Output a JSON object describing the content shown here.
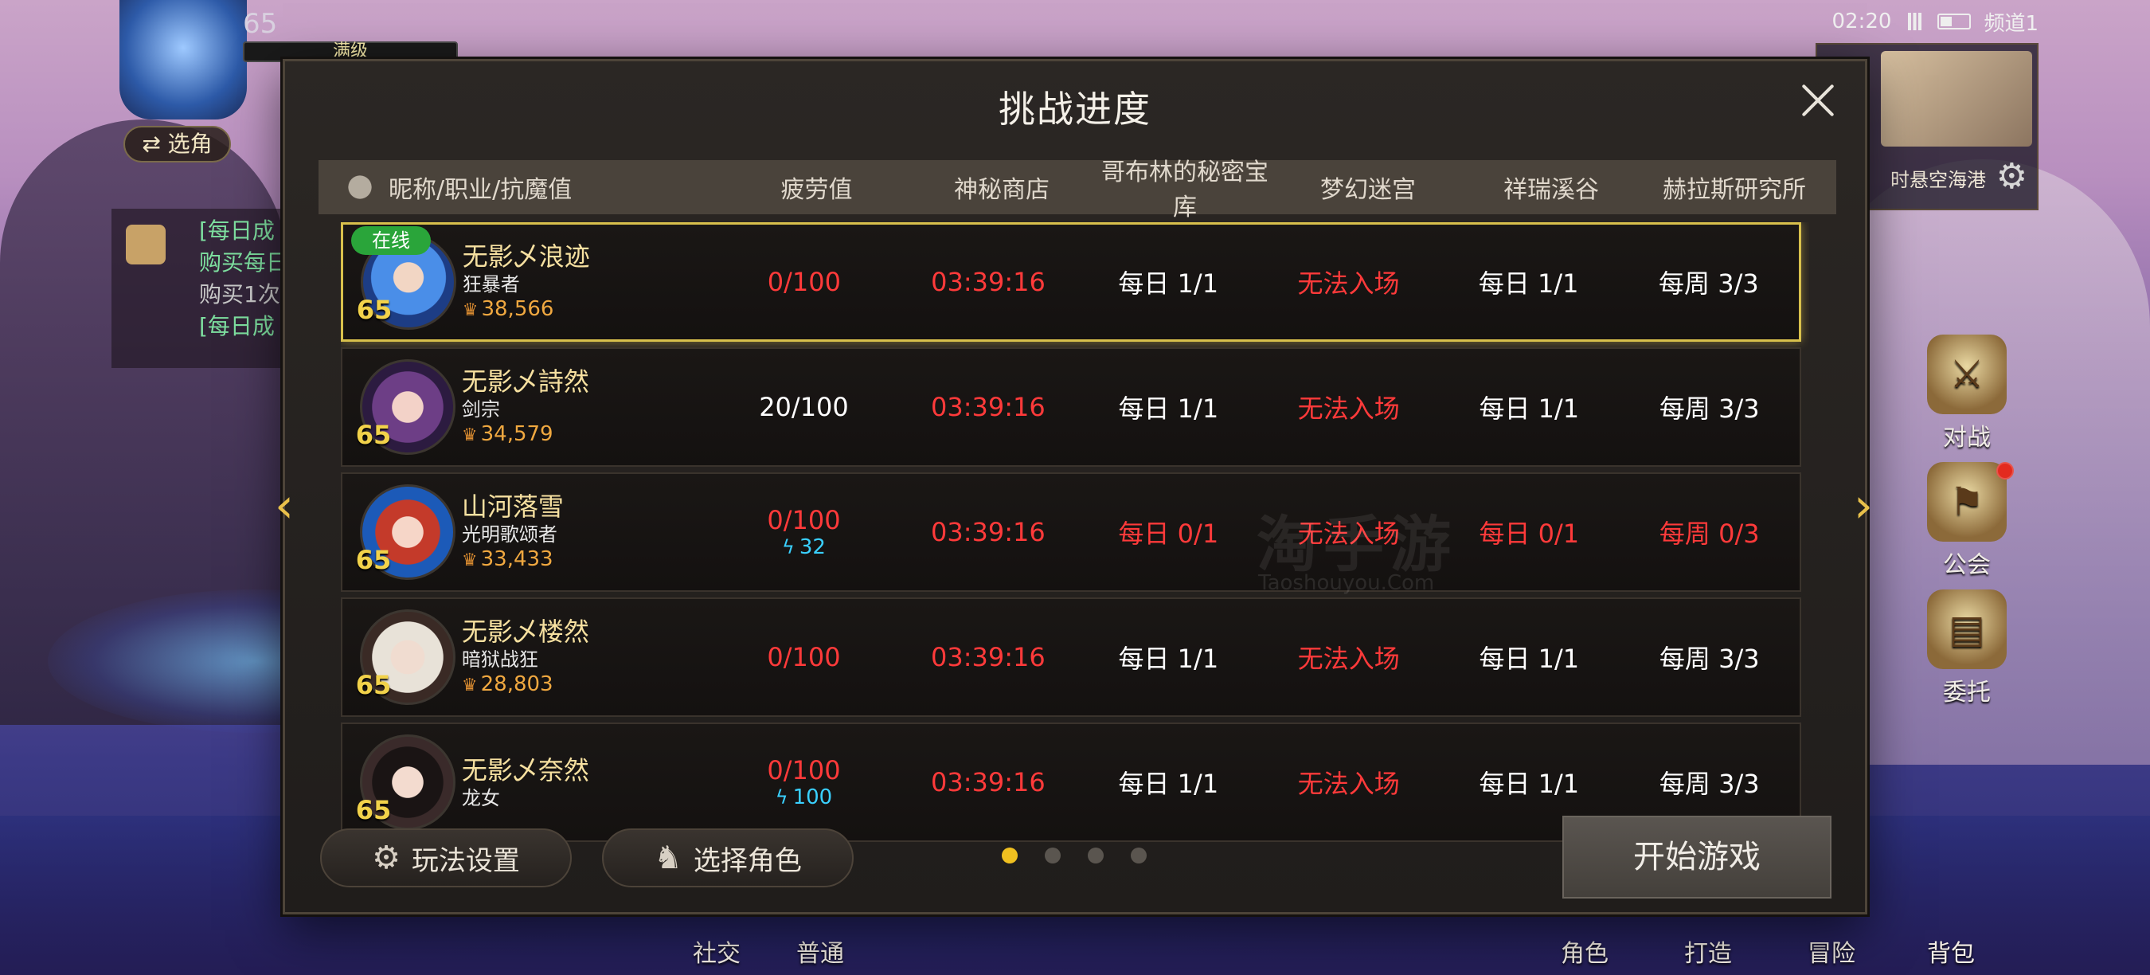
{
  "hud": {
    "level": "65",
    "status_label": "满级",
    "select_role": "⇄ 选角",
    "chat": [
      {
        "text": "[每日成",
        "color": "green"
      },
      {
        "text": "购买每日",
        "color": "green"
      },
      {
        "text": "购买1次",
        "color": "gray"
      },
      {
        "text": "[每日成",
        "color": "green"
      }
    ],
    "time": "02:20",
    "channel": "频道1",
    "map_name": "时悬空海港"
  },
  "side_buttons": [
    {
      "label": "对战",
      "icon": "crossed-swords-icon"
    },
    {
      "label": "公会",
      "icon": "guild-banner-icon"
    },
    {
      "label": "委托",
      "icon": "notice-board-icon"
    }
  ],
  "bottom_bar": {
    "social": "社交",
    "normal": "普通",
    "role": "角色",
    "forge": "打造",
    "adventure": "冒险",
    "bag": "背包"
  },
  "modal": {
    "title": "挑战进度",
    "columns": {
      "name": "昵称/职业/抗魔值",
      "fatigue": "疲劳值",
      "shop": "神秘商店",
      "goblin": "哥布林的秘密宝库",
      "maze": "梦幻迷宫",
      "valley": "祥瑞溪谷",
      "lab": "赫拉斯研究所"
    },
    "online_label": "在线",
    "rows": [
      {
        "name": "无影乄浪迹",
        "class": "狂暴者",
        "level": "65",
        "power": "38,566",
        "fatigue": "0/100",
        "fatigue_extra": "",
        "shop": "03:39:16",
        "goblin": "每日 1/1",
        "maze": "无法入场",
        "valley": "每日 1/1",
        "lab": "每周 3/3"
      },
      {
        "name": "无影乄詩然",
        "class": "剑宗",
        "level": "65",
        "power": "34,579",
        "fatigue": "20/100",
        "fatigue_extra": "",
        "shop": "03:39:16",
        "goblin": "每日 1/1",
        "maze": "无法入场",
        "valley": "每日 1/1",
        "lab": "每周 3/3"
      },
      {
        "name": "山河落雪",
        "class": "光明歌颂者",
        "level": "65",
        "power": "33,433",
        "fatigue": "0/100",
        "fatigue_extra": "32",
        "shop": "03:39:16",
        "goblin": "每日 0/1",
        "maze": "无法入场",
        "valley": "每日 0/1",
        "lab": "每周 0/3"
      },
      {
        "name": "无影乄楼然",
        "class": "暗狱战狂",
        "level": "65",
        "power": "28,803",
        "fatigue": "0/100",
        "fatigue_extra": "",
        "shop": "03:39:16",
        "goblin": "每日 1/1",
        "maze": "无法入场",
        "valley": "每日 1/1",
        "lab": "每周 3/3"
      },
      {
        "name": "无影乄奈然",
        "class": "龙女",
        "level": "65",
        "power": "",
        "fatigue": "0/100",
        "fatigue_extra": "100",
        "shop": "03:39:16",
        "goblin": "每日 1/1",
        "maze": "无法入场",
        "valley": "每日 1/1",
        "lab": "每周 3/3"
      }
    ],
    "buttons": {
      "settings": "玩法设置",
      "select_character": "选择角色",
      "start": "开始游戏"
    },
    "page_count": 4,
    "active_page": 1
  },
  "watermark": {
    "main": "淘手游",
    "sub": "Taoshouyou.Com"
  },
  "colors": {
    "accent_gold": "#d8c04c",
    "red_value": "#ff3a3a",
    "online_green": "#2aa53a",
    "dot_active": "#f0c020"
  }
}
